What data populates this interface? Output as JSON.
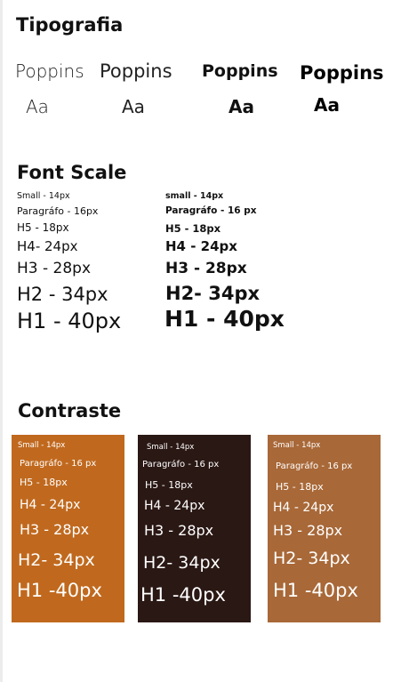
{
  "tipografia": {
    "title": "Tipografia",
    "samples": [
      {
        "name": "Poppins",
        "glyph": "Aa",
        "weight": "light"
      },
      {
        "name": "Poppins",
        "glyph": "Aa",
        "weight": "regular"
      },
      {
        "name": "Poppins",
        "glyph": "Aa",
        "weight": "semibold"
      },
      {
        "name": "Poppins",
        "glyph": "Aa",
        "weight": "bold"
      }
    ]
  },
  "font_scale": {
    "title": "Font Scale",
    "regular": [
      "Small - 14px",
      "Paragráfo - 16px",
      "H5 - 18px",
      "H4- 24px",
      "H3 - 28px",
      "H2 - 34px",
      "H1 - 40px"
    ],
    "bold": [
      "small - 14px",
      "Paragráfo - 16 px",
      "H5 - 18px",
      "H4 - 24px",
      "H3 - 28px",
      "H2- 34px",
      "H1 - 40px"
    ]
  },
  "contraste": {
    "title": "Contraste",
    "cards": [
      {
        "color": "#c0691e",
        "lines": [
          "Small - 14px",
          "Paragráfo - 16 px",
          "H5 - 18px",
          "H4 - 24px",
          "H3 - 28px",
          "H2- 34px",
          "H1 -40px"
        ]
      },
      {
        "color": "#2a1814",
        "lines": [
          "Small - 14px",
          "Paragráfo - 16 px",
          "H5 - 18px",
          "H4 - 24px",
          "H3 - 28px",
          "H2- 34px",
          "H1 -40px"
        ]
      },
      {
        "color": "#a86838",
        "lines": [
          "Small - 14px",
          "Paragráfo - 16 px",
          "H5 - 18px",
          "H4 - 24px",
          "H3 - 28px",
          "H2- 34px",
          "H1 -40px"
        ]
      }
    ]
  }
}
